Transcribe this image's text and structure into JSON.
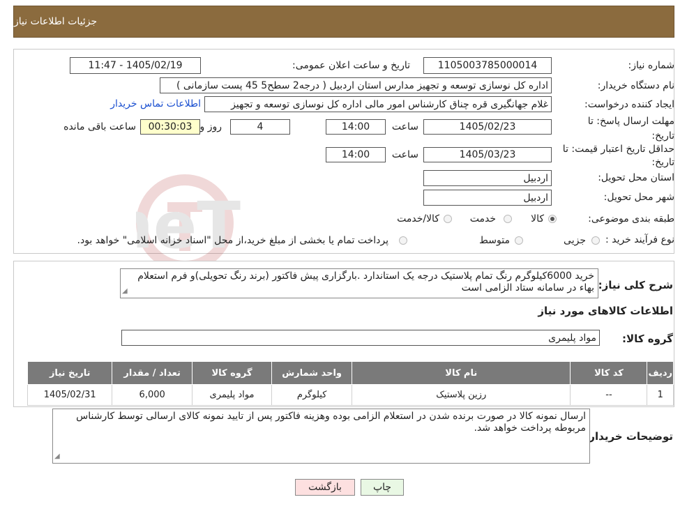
{
  "header": {
    "title": "جزئیات اطلاعات نیاز"
  },
  "form": {
    "need_number_label": "شماره نیاز:",
    "need_number": "1105003785000014",
    "announce_label": "تاریخ و ساعت اعلان عمومی:",
    "announce_value": "1405/02/19 - 11:47",
    "buyer_org_label": "نام دستگاه خریدار:",
    "buyer_org": "اداره کل نوسازی   توسعه و تجهیز مدارس استان اردبیل ( درجه2  سطح5  45 پست سازمانی )",
    "creator_label": "ایجاد کننده درخواست:",
    "creator": "غلام جهانگیری قره چناق کارشناس امور مالی اداره کل نوسازی   توسعه و تجهیز",
    "contact_link": "اطلاعات تماس خریدار",
    "deadline_label": "مهلت ارسال پاسخ: تا تاریخ:",
    "deadline_date": "1405/02/23",
    "time_label": "ساعت",
    "deadline_time": "14:00",
    "days": "4",
    "days_label": "روز و",
    "remaining": "00:30:03",
    "remaining_label": "ساعت باقی مانده",
    "validity_label": "حداقل تاریخ اعتبار قیمت: تا تاریخ:",
    "validity_date": "1405/03/23",
    "validity_time": "14:00",
    "province_label": "استان محل تحویل:",
    "province": "اردبیل",
    "city_label": "شهر محل تحویل:",
    "city": "اردبیل",
    "category_label": "طبقه بندی موضوعی:",
    "category_options": [
      "کالا",
      "خدمت",
      "کالا/خدمت"
    ],
    "process_label": "نوع فرآیند خرید :",
    "process_options": [
      "جزیی",
      "متوسط"
    ],
    "process_note": "پرداخت تمام یا بخشی از مبلغ خرید،از محل \"اسناد خزانه اسلامی\" خواهد بود."
  },
  "description": {
    "label": "شرح کلی نیاز:",
    "text": "خرید 6000کیلوگرم رنگ تمام پلاستیک درجه یک استاندارد .بارگزاری پیش فاکتور (برند رنگ تحویلی)و فرم استعلام بهاء در سامانه ستاد الزامی است"
  },
  "goods": {
    "section_title": "اطلاعات کالاهای مورد نیاز",
    "group_label": "گروه کالا:",
    "group_value": "مواد پلیمری",
    "columns": [
      "ردیف",
      "کد کالا",
      "نام کالا",
      "واحد شمارش",
      "گروه کالا",
      "تعداد / مقدار",
      "تاریخ نیاز"
    ],
    "rows": [
      [
        "1",
        "--",
        "رزین پلاستیک",
        "کیلوگرم",
        "مواد پلیمری",
        "6,000",
        "1405/02/31"
      ]
    ]
  },
  "buyer_notes": {
    "label": "توضیحات خریدار:",
    "text": "ارسال نمونه کالا در صورت برنده شدن در استعلام الزامی بوده وهزینه فاکتور پس از تایید نمونه کالای ارسالی توسط کارشناس مربوطه پرداخت خواهد شد."
  },
  "buttons": {
    "print": "چاپ",
    "back": "بازگشت"
  },
  "colors": {
    "header_bg": "#8b6b3e",
    "remaining_bg": "#ffffcc",
    "back_bg": "#fde0e0",
    "print_bg": "#e9f8e4",
    "link": "#1a4fd0"
  },
  "watermark_text": "AriaTender.neT"
}
